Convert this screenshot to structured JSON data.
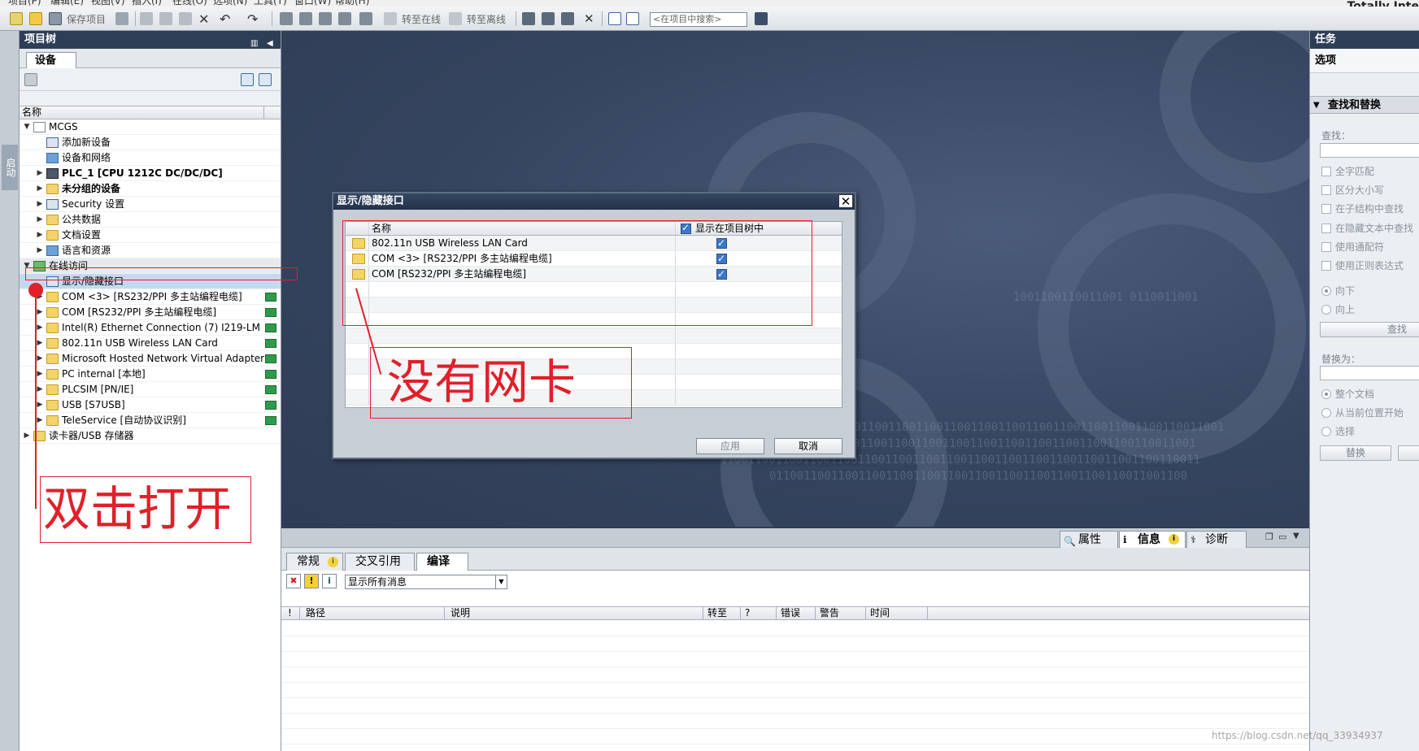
{
  "window": {
    "app_title": "Totally Inte",
    "menu": [
      "项目(P)",
      "编辑(E)",
      "视图(V)",
      "插入(I)",
      "在线(O)",
      "选项(N)",
      "工具(T)",
      "窗口(W)",
      "帮助(H)"
    ]
  },
  "toolbar": {
    "save_project": "保存项目",
    "go_online": "转至在线",
    "go_offline": "转至离线",
    "search_placeholder": "<在项目中搜索>"
  },
  "left_strip": {
    "start_label": "启动"
  },
  "project_tree": {
    "title": "项目树",
    "tab_devices": "设备",
    "column_name": "名称",
    "items": [
      {
        "label": "MCGS",
        "level": 0,
        "arrow": "▼",
        "icon": "doc-icon"
      },
      {
        "label": "添加新设备",
        "level": 1,
        "arrow": "",
        "icon": "add-device-icon"
      },
      {
        "label": "设备和网络",
        "level": 1,
        "arrow": "",
        "icon": "network-icon"
      },
      {
        "label": "PLC_1 [CPU 1212C DC/DC/DC]",
        "level": 1,
        "arrow": "▶",
        "icon": "plc-icon",
        "bold": true
      },
      {
        "label": "未分组的设备",
        "level": 1,
        "arrow": "▶",
        "icon": "folder-icon",
        "bold": true
      },
      {
        "label": "Security 设置",
        "level": 1,
        "arrow": "▶",
        "icon": "security-icon"
      },
      {
        "label": "公共数据",
        "level": 1,
        "arrow": "▶",
        "icon": "folder-icon"
      },
      {
        "label": "文档设置",
        "level": 1,
        "arrow": "▶",
        "icon": "folder-icon"
      },
      {
        "label": "语言和资源",
        "level": 1,
        "arrow": "▶",
        "icon": "language-icon"
      },
      {
        "label": "在线访问",
        "level": 0,
        "arrow": "▼",
        "icon": "online-access-icon"
      },
      {
        "label": "显示/隐藏接口",
        "level": 1,
        "arrow": "",
        "icon": "interface-icon",
        "selected": true
      },
      {
        "label": "COM <3> [RS232/PPI 多主站编程电缆]",
        "level": 1,
        "arrow": "▶",
        "icon": "folder-icon",
        "status": true
      },
      {
        "label": "COM [RS232/PPI 多主站编程电缆]",
        "level": 1,
        "arrow": "▶",
        "icon": "folder-icon",
        "status": true
      },
      {
        "label": "Intel(R) Ethernet Connection (7) I219-LM",
        "level": 1,
        "arrow": "▶",
        "icon": "folder-icon",
        "status": true
      },
      {
        "label": "802.11n USB Wireless LAN Card",
        "level": 1,
        "arrow": "▶",
        "icon": "folder-icon",
        "status": true
      },
      {
        "label": "Microsoft Hosted Network Virtual Adapter",
        "level": 1,
        "arrow": "▶",
        "icon": "folder-icon",
        "status": true
      },
      {
        "label": "PC internal [本地]",
        "level": 1,
        "arrow": "▶",
        "icon": "folder-icon",
        "status": true
      },
      {
        "label": "PLCSIM [PN/IE]",
        "level": 1,
        "arrow": "▶",
        "icon": "folder-icon",
        "status": true
      },
      {
        "label": "USB [S7USB]",
        "level": 1,
        "arrow": "▶",
        "icon": "folder-icon",
        "status": true
      },
      {
        "label": "TeleService [自动协议识别]",
        "level": 1,
        "arrow": "▶",
        "icon": "folder-icon",
        "status": true
      },
      {
        "label": "读卡器/USB 存储器",
        "level": 0,
        "arrow": "▶",
        "icon": "card-reader-icon"
      }
    ]
  },
  "dialog": {
    "title": "显示/隐藏接口",
    "col_name": "名称",
    "col_show": "显示在项目树中",
    "rows": [
      {
        "name": "802.11n USB Wireless LAN Card",
        "checked": true
      },
      {
        "name": "COM <3> [RS232/PPI 多主站编程电缆]",
        "checked": true
      },
      {
        "name": "COM [RS232/PPI 多主站编程电缆]",
        "checked": true
      }
    ],
    "apply": "应用",
    "cancel": "取消"
  },
  "annotations": {
    "no_nic": "没有网卡",
    "double_click_open": "双击打开",
    "color": "#e0202a"
  },
  "info_area": {
    "tabs": {
      "properties": "属性",
      "info": "信息",
      "diagnostics": "诊断"
    },
    "sub_tabs": {
      "general": "常规",
      "cross_ref": "交叉引用",
      "compile": "编译"
    },
    "filter": "显示所有消息",
    "columns": [
      "!",
      "路径",
      "说明",
      "转至",
      "?",
      "错误",
      "警告",
      "时间"
    ]
  },
  "task_panel": {
    "title": "任务",
    "options": "选项",
    "find_replace": "查找和替换",
    "find_label": "查找：",
    "checks": [
      "全字匹配",
      "区分大小写",
      "在子结构中查找",
      "在隐藏文本中查找",
      "使用通配符",
      "使用正则表达式"
    ],
    "dir_down": "向下",
    "dir_up": "向上",
    "find_btn": "查找",
    "replace_label": "替换为：",
    "scope": [
      "整个文档",
      "从当前位置开始",
      "选择"
    ],
    "replace_btn": "替换"
  },
  "watermark": "https://blog.csdn.net/qq_33934937"
}
